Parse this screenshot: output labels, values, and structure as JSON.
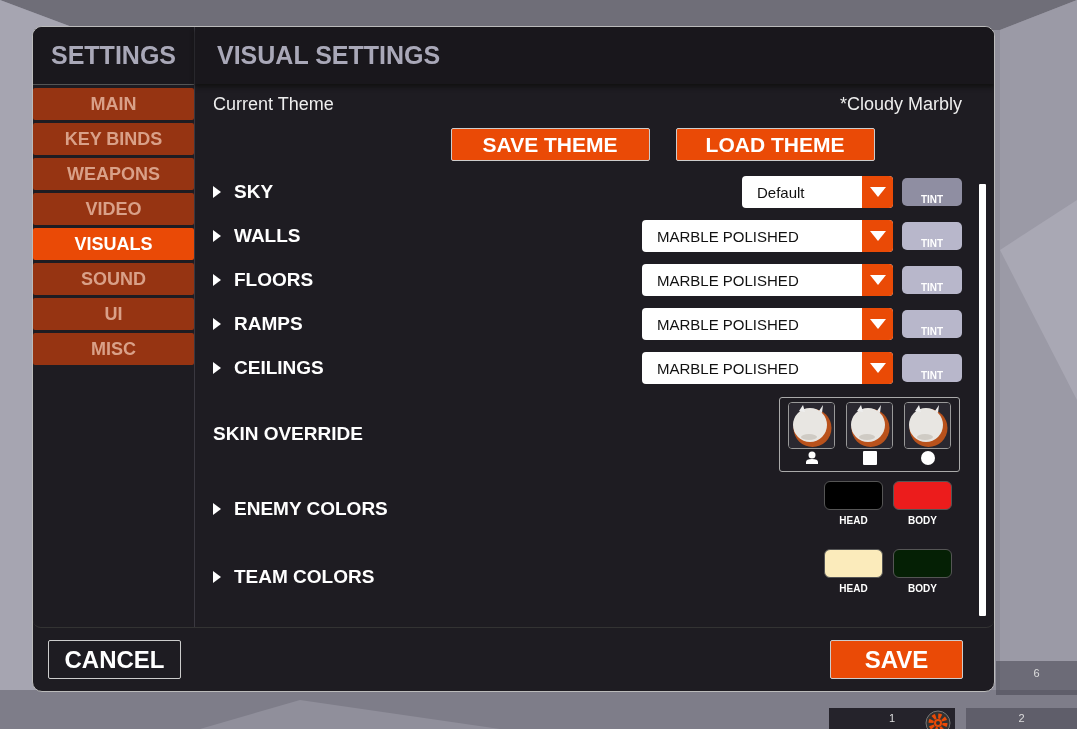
{
  "sidebar": {
    "title": "SETTINGS",
    "items": [
      {
        "label": "MAIN",
        "selected": false
      },
      {
        "label": "KEY BINDS",
        "selected": false
      },
      {
        "label": "WEAPONS",
        "selected": false
      },
      {
        "label": "VIDEO",
        "selected": false
      },
      {
        "label": "VISUALS",
        "selected": true
      },
      {
        "label": "SOUND",
        "selected": false
      },
      {
        "label": "UI",
        "selected": false
      },
      {
        "label": "MISC",
        "selected": false
      }
    ]
  },
  "panel": {
    "title": "VISUAL SETTINGS",
    "theme_label": "Current Theme",
    "theme_value": "*Cloudy Marbly",
    "theme_buttons": [
      "SAVE THEME",
      "LOAD THEME"
    ],
    "rows": [
      {
        "kind": "dropdown",
        "label": "SKY",
        "expandable": true,
        "value": "Default",
        "tint": "TINT",
        "tint_disabled": true
      },
      {
        "kind": "dropdown",
        "label": "WALLS",
        "expandable": true,
        "value": "MARBLE POLISHED",
        "tint": "TINT",
        "tint_disabled": false
      },
      {
        "kind": "dropdown",
        "label": "FLOORS",
        "expandable": true,
        "value": "MARBLE POLISHED",
        "tint": "TINT",
        "tint_disabled": false
      },
      {
        "kind": "dropdown",
        "label": "RAMPS",
        "expandable": true,
        "value": "MARBLE POLISHED",
        "tint": "TINT",
        "tint_disabled": false
      },
      {
        "kind": "dropdown",
        "label": "CEILINGS",
        "expandable": true,
        "value": "MARBLE POLISHED",
        "tint": "TINT",
        "tint_disabled": false
      },
      {
        "kind": "skins",
        "label": "SKIN OVERRIDE",
        "expandable": false
      },
      {
        "kind": "colors",
        "label": "ENEMY COLORS",
        "expandable": true,
        "swatches": [
          {
            "label": "HEAD",
            "color": "#000000"
          },
          {
            "label": "BODY",
            "color": "#ec1c1c"
          }
        ]
      },
      {
        "kind": "colors",
        "label": "TEAM COLORS",
        "expandable": true,
        "swatches": [
          {
            "label": "HEAD",
            "color": "#fbebbb"
          },
          {
            "label": "BODY",
            "color": "#052005"
          }
        ]
      }
    ]
  },
  "footer": {
    "cancel": "CANCEL",
    "save": "SAVE"
  },
  "hud": [
    {
      "label": "6",
      "kind": "plain"
    },
    {
      "label": "1",
      "kind": "gear"
    },
    {
      "label": "2",
      "kind": "plain"
    }
  ]
}
